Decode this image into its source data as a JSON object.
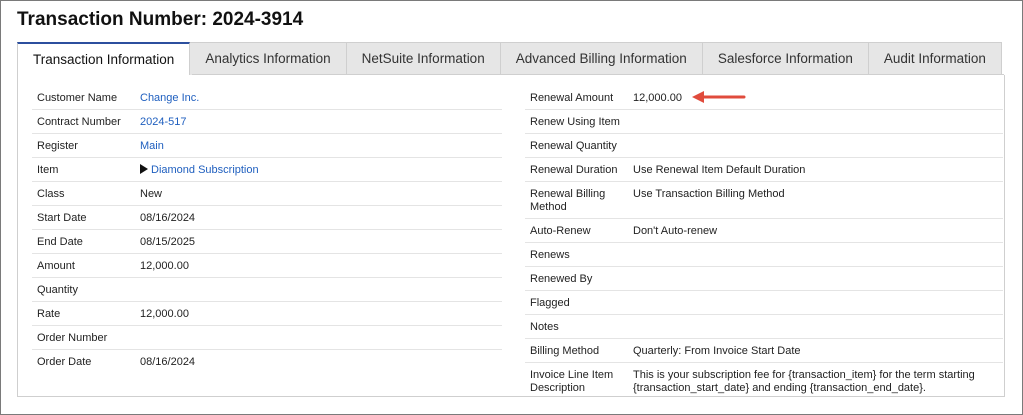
{
  "page_title": "Transaction Number: 2024-3914",
  "tabs": [
    {
      "label": "Transaction Information",
      "active": true
    },
    {
      "label": "Analytics Information",
      "active": false
    },
    {
      "label": "NetSuite Information",
      "active": false
    },
    {
      "label": "Advanced Billing Information",
      "active": false
    },
    {
      "label": "Salesforce Information",
      "active": false
    },
    {
      "label": "Audit Information",
      "active": false
    }
  ],
  "left_fields": [
    {
      "label": "Customer Name",
      "value": "Change Inc."
    },
    {
      "label": "Contract Number",
      "value": "2024-517"
    },
    {
      "label": "Register",
      "value": "Main"
    },
    {
      "label": "Item",
      "value": "Diamond Subscription"
    },
    {
      "label": "Class",
      "value": "New"
    },
    {
      "label": "Start Date",
      "value": "08/16/2024"
    },
    {
      "label": "End Date",
      "value": "08/15/2025"
    },
    {
      "label": "Amount",
      "value": "12,000.00"
    },
    {
      "label": "Quantity",
      "value": ""
    },
    {
      "label": "Rate",
      "value": "12,000.00"
    },
    {
      "label": "Order Number",
      "value": ""
    },
    {
      "label": "Order Date",
      "value": "08/16/2024"
    }
  ],
  "right_fields": [
    {
      "label": "Renewal Amount",
      "value": "12,000.00"
    },
    {
      "label": "Renew Using Item",
      "value": ""
    },
    {
      "label": "Renewal Quantity",
      "value": ""
    },
    {
      "label": "Renewal Duration",
      "value": "Use Renewal Item Default Duration"
    },
    {
      "label": "Renewal Billing Method",
      "value": "Use Transaction Billing Method"
    },
    {
      "label": "Auto-Renew",
      "value": "Don't Auto-renew"
    },
    {
      "label": "Renews",
      "value": ""
    },
    {
      "label": "Renewed By",
      "value": ""
    },
    {
      "label": "Flagged",
      "value": ""
    },
    {
      "label": "Notes",
      "value": ""
    },
    {
      "label": "Billing Method",
      "value": "Quarterly: From Invoice Start Date"
    },
    {
      "label": "Invoice Line Item Description",
      "value": "This is your subscription fee for {transaction_item} for the term starting {transaction_start_date} and ending {transaction_end_date}."
    }
  ],
  "colors": {
    "link": "#1f5fbf",
    "tab_accent": "#2c4f9e",
    "annotation_arrow": "#e04b3c"
  },
  "icons": {
    "item_expand": "triangle-right-icon",
    "annotation": "red-arrow-icon"
  }
}
